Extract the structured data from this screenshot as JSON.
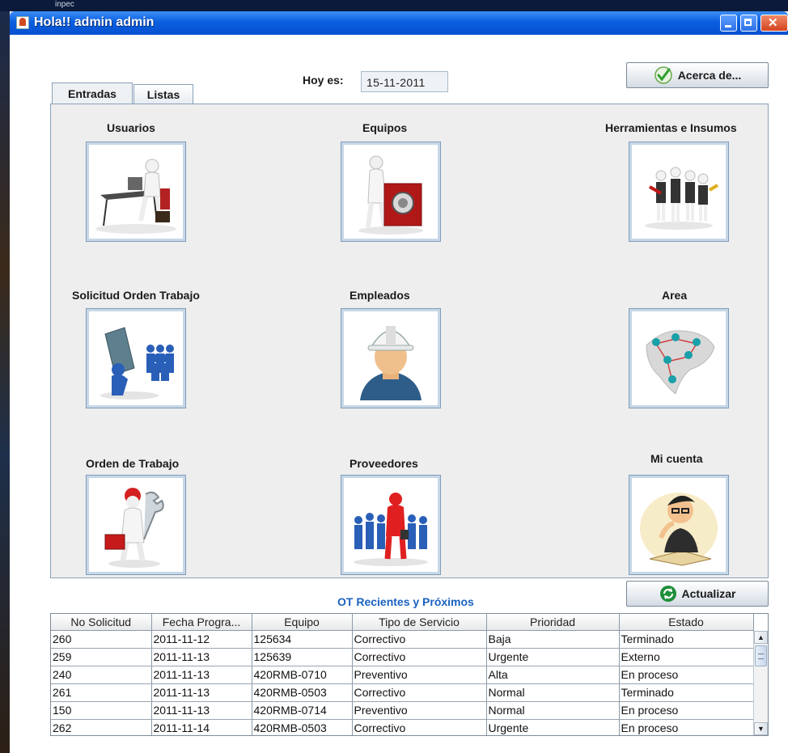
{
  "desktop": {
    "taskbar_text": "inpec"
  },
  "window": {
    "title": "Hola!! admin admin"
  },
  "header": {
    "date_label": "Hoy es:",
    "date_value": "15-11-2011",
    "about_button": "Acerca de..."
  },
  "tabs": [
    {
      "label": "Entradas",
      "active": true
    },
    {
      "label": "Listas",
      "active": false
    }
  ],
  "tiles": [
    {
      "label": "Usuarios",
      "icon": "user-desk-icon"
    },
    {
      "label": "Equipos",
      "icon": "equipment-icon"
    },
    {
      "label": "Herramientas e Insumos",
      "icon": "tools-team-icon"
    },
    {
      "label": "Solicitud Orden Trabajo",
      "icon": "work-request-icon"
    },
    {
      "label": "Empleados",
      "icon": "worker-helmet-icon"
    },
    {
      "label": "Area",
      "icon": "area-network-map-icon"
    },
    {
      "label": "Orden de Trabajo",
      "icon": "wrench-toolbox-icon"
    },
    {
      "label": "Proveedores",
      "icon": "suppliers-group-icon"
    },
    {
      "label": "Mi cuenta",
      "icon": "account-thinking-icon"
    }
  ],
  "recent": {
    "title": "OT Recientes y Próximos",
    "refresh_button": "Actualizar",
    "columns": [
      "No Solicitud",
      "Fecha Progra...",
      "Equipo",
      "Tipo de Servicio",
      "Prioridad",
      "Estado"
    ],
    "rows": [
      [
        "260",
        "2011-11-12",
        "125634",
        "Correctivo",
        "Baja",
        "Terminado"
      ],
      [
        "259",
        "2011-11-13",
        "125639",
        "Correctivo",
        "Urgente",
        "Externo"
      ],
      [
        "240",
        "2011-11-13",
        "420RMB-0710",
        "Preventivo",
        "Alta",
        "En proceso"
      ],
      [
        "261",
        "2011-11-13",
        "420RMB-0503",
        "Correctivo",
        "Normal",
        "Terminado"
      ],
      [
        "150",
        "2011-11-13",
        "420RMB-0714",
        "Preventivo",
        "Normal",
        "En proceso"
      ],
      [
        "262",
        "2011-11-14",
        "420RMB-0503",
        "Correctivo",
        "Urgente",
        "En proceso"
      ]
    ]
  },
  "colors": {
    "titlebar": "#0a5fe0",
    "accent_text": "#1a62c0",
    "panel_bg": "#eeeeee"
  }
}
